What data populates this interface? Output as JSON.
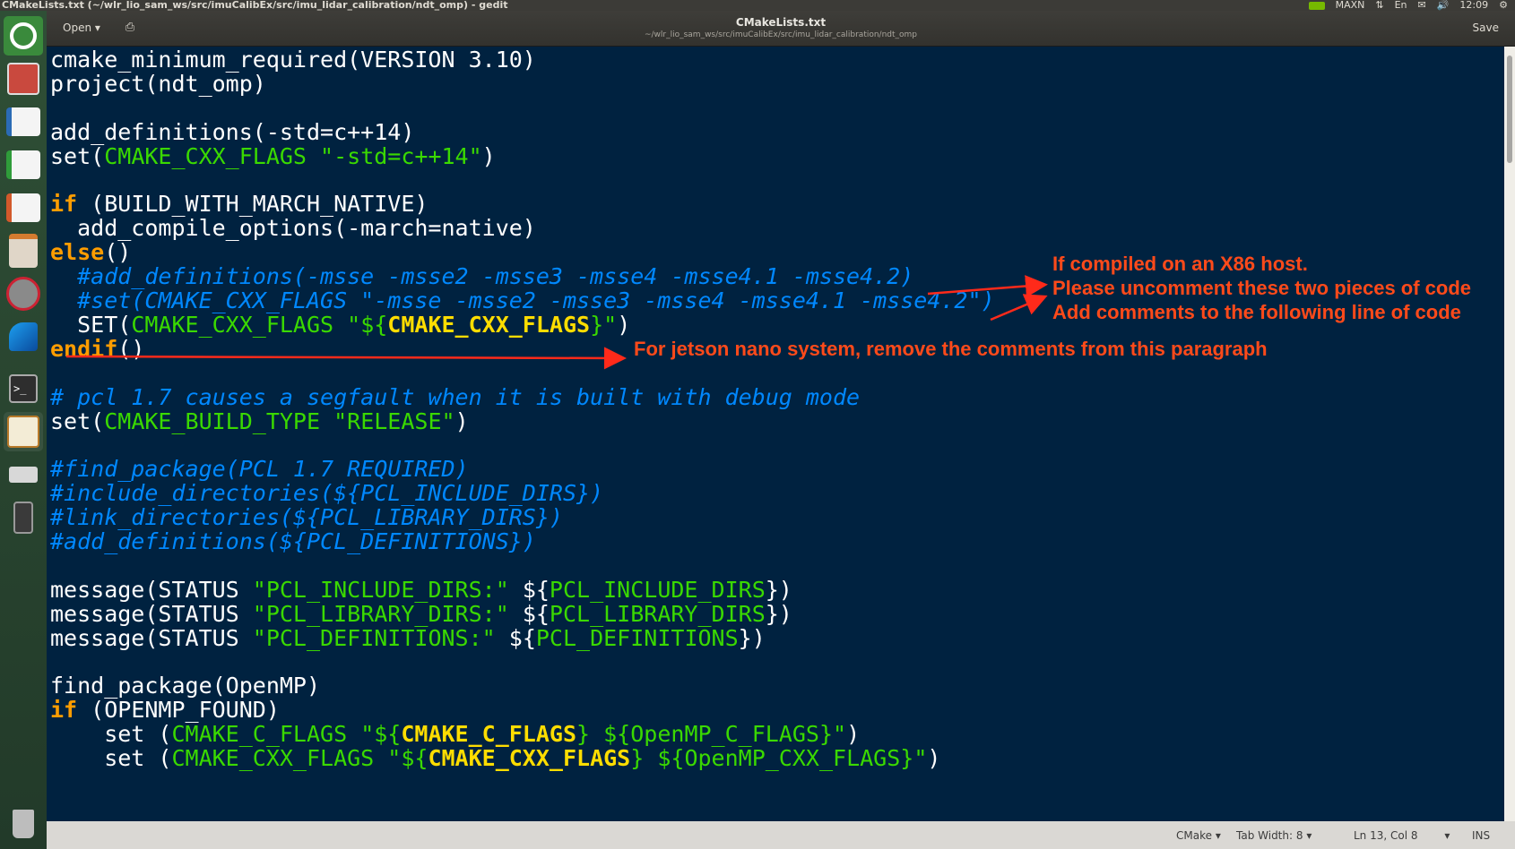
{
  "system_bar": {
    "window_title": "CMakeLists.txt (~/wlr_lio_sam_ws/src/imuCalibEx/src/imu_lidar_calibration/ndt_omp) - gedit",
    "power_mode": "MAXN",
    "keyboard": "En",
    "time": "12:09"
  },
  "header": {
    "open_label": "Open",
    "title": "CMakeLists.txt",
    "path": "~/wlr_lio_sam_ws/src/imuCalibEx/src/imu_lidar_calibration/ndt_omp",
    "save_label": "Save"
  },
  "code": [
    [
      [
        "w",
        "cmake_minimum_required(VERSION 3.10)"
      ]
    ],
    [
      [
        "w",
        "project(ndt_omp)"
      ]
    ],
    [],
    [
      [
        "w",
        "add_definitions(-std=c++14)"
      ]
    ],
    [
      [
        "w",
        "set("
      ],
      [
        "v",
        "CMAKE_CXX_FLAGS "
      ],
      [
        "s",
        "\"-std=c++14\""
      ],
      [
        "w",
        ")"
      ]
    ],
    [],
    [
      [
        "k",
        "if"
      ],
      [
        "w",
        " (BUILD_WITH_MARCH_NATIVE)"
      ]
    ],
    [
      [
        "w",
        "  add_compile_options(-march=native)"
      ]
    ],
    [
      [
        "k",
        "else"
      ],
      [
        "w",
        "()"
      ]
    ],
    [
      [
        "c",
        "  #add_definitions(-msse -msse2 -msse3 -msse4 -msse4.1 -msse4.2)"
      ]
    ],
    [
      [
        "c",
        "  #set(CMAKE_CXX_FLAGS \"-msse -msse2 -msse3 -msse4 -msse4.1 -msse4.2\")"
      ]
    ],
    [
      [
        "w",
        "  SET("
      ],
      [
        "v",
        "CMAKE_CXX_FLAGS "
      ],
      [
        "s",
        "\"${"
      ],
      [
        "y",
        "CMAKE_CXX_FLAGS"
      ],
      [
        "s",
        "}\""
      ],
      [
        "w",
        ")"
      ]
    ],
    [
      [
        "k",
        "endif"
      ],
      [
        "w",
        "()"
      ]
    ],
    [],
    [
      [
        "c",
        "# pcl 1.7 causes a segfault when it is built with debug mode"
      ]
    ],
    [
      [
        "w",
        "set("
      ],
      [
        "v",
        "CMAKE_BUILD_TYPE "
      ],
      [
        "s",
        "\"RELEASE\""
      ],
      [
        "w",
        ")"
      ]
    ],
    [],
    [
      [
        "c",
        "#find_package(PCL 1.7 REQUIRED)"
      ]
    ],
    [
      [
        "c",
        "#include_directories(${PCL_INCLUDE_DIRS})"
      ]
    ],
    [
      [
        "c",
        "#link_directories(${PCL_LIBRARY_DIRS})"
      ]
    ],
    [
      [
        "c",
        "#add_definitions(${PCL_DEFINITIONS})"
      ]
    ],
    [],
    [
      [
        "w",
        "message(STATUS "
      ],
      [
        "s",
        "\"PCL_INCLUDE_DIRS:\""
      ],
      [
        "w",
        " ${"
      ],
      [
        "v",
        "PCL_INCLUDE_DIRS"
      ],
      [
        "w",
        "})"
      ]
    ],
    [
      [
        "w",
        "message(STATUS "
      ],
      [
        "s",
        "\"PCL_LIBRARY_DIRS:\""
      ],
      [
        "w",
        " ${"
      ],
      [
        "v",
        "PCL_LIBRARY_DIRS"
      ],
      [
        "w",
        "})"
      ]
    ],
    [
      [
        "w",
        "message(STATUS "
      ],
      [
        "s",
        "\"PCL_DEFINITIONS:\""
      ],
      [
        "w",
        " ${"
      ],
      [
        "v",
        "PCL_DEFINITIONS"
      ],
      [
        "w",
        "})"
      ]
    ],
    [],
    [
      [
        "w",
        "find_package(OpenMP)"
      ]
    ],
    [
      [
        "k",
        "if"
      ],
      [
        "w",
        " (OPENMP_FOUND)"
      ]
    ],
    [
      [
        "w",
        "    set ("
      ],
      [
        "v",
        "CMAKE_C_FLAGS "
      ],
      [
        "s",
        "\"${"
      ],
      [
        "y",
        "CMAKE_C_FLAGS"
      ],
      [
        "s",
        "} ${"
      ],
      [
        "v",
        "OpenMP_C_FLAGS"
      ],
      [
        "s",
        "}\""
      ],
      [
        "w",
        ")"
      ]
    ],
    [
      [
        "w",
        "    set ("
      ],
      [
        "v",
        "CMAKE_CXX_FLAGS "
      ],
      [
        "s",
        "\"${"
      ],
      [
        "y",
        "CMAKE_CXX_FLAGS"
      ],
      [
        "s",
        "} ${"
      ],
      [
        "v",
        "OpenMP_CXX_FLAGS"
      ],
      [
        "s",
        "}\""
      ],
      [
        "w",
        ")"
      ]
    ]
  ],
  "annotations": {
    "x86_line1": "If compiled on an X86 host.",
    "x86_line2": "Please uncomment these two pieces of code",
    "x86_line3": "Add comments to the following line of code",
    "jetson": "For jetson nano system, remove the comments from this paragraph"
  },
  "colors": {
    "annotation": "#ff4a1a",
    "editor_bg": "#002240"
  },
  "status_bar": {
    "language": "CMake",
    "tab_width": "Tab Width: 8",
    "position": "Ln 13, Col 8",
    "mode": "INS"
  },
  "launcher_icons": [
    "ubuntu-logo-icon",
    "files-icon",
    "writer-icon",
    "calc-icon",
    "impress-icon",
    "software-center-icon",
    "settings-icon",
    "app-icon",
    "terminal-icon",
    "text-editor-icon",
    "drive-icon",
    "device-icon",
    "trash-icon"
  ]
}
